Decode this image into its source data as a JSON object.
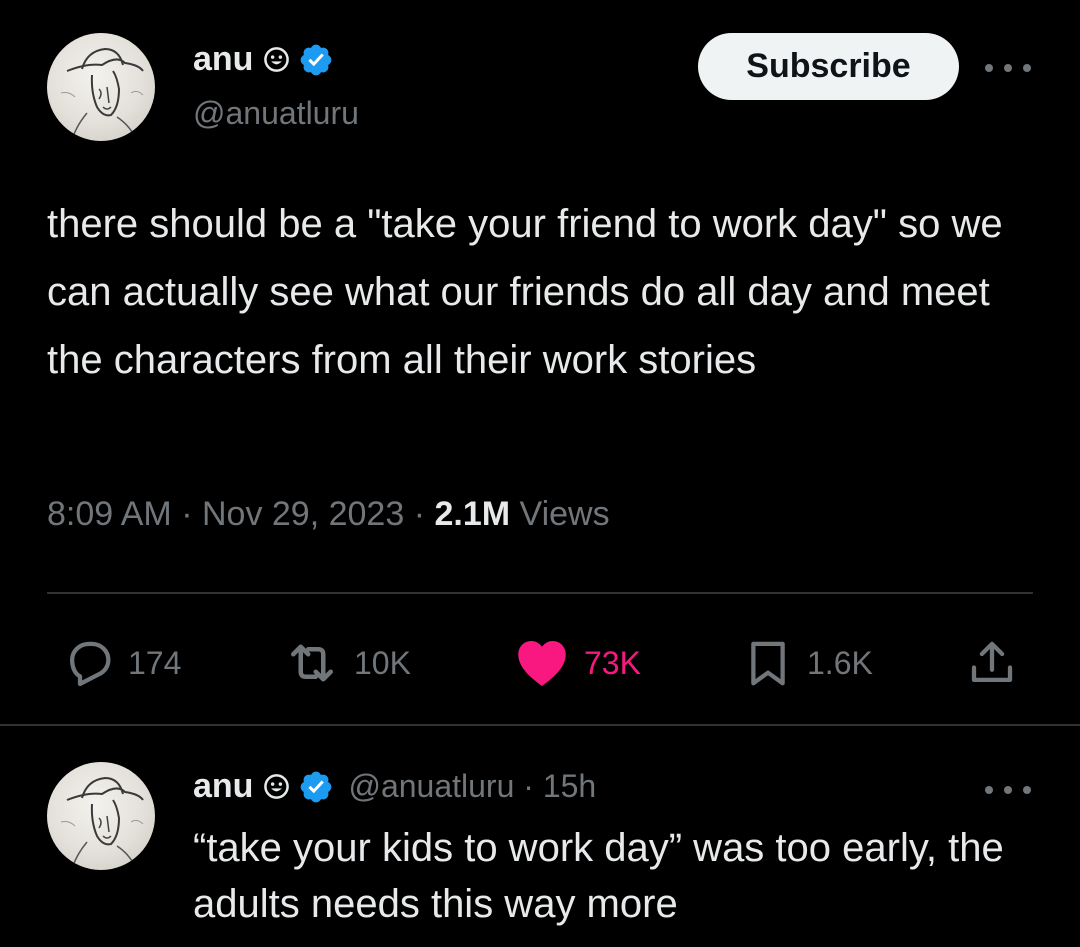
{
  "colors": {
    "background": "#000000",
    "text_primary": "#e7e9ea",
    "text_secondary": "#71767b",
    "verified_blue": "#1d9bf0",
    "like_pink": "#f91880",
    "divider": "#2f3336",
    "subscribe_bg": "#eff3f4"
  },
  "tweet": {
    "author": {
      "display_name": "anu",
      "emoji_icon": "smiley-face-icon",
      "verified_icon": "verified-badge-icon",
      "handle": "@anuatluru",
      "avatar_icon": "cowboy-sketch-avatar"
    },
    "subscribe_label": "Subscribe",
    "more_icon": "more-dots-icon",
    "text": "there should be a \"take your friend to work day\" so we can actually see what our friends do all day and meet the characters from all their work stories",
    "time": "8:09 AM",
    "separator": "·",
    "date": "Nov 29, 2023",
    "views_count": "2.1M",
    "views_label": "Views",
    "actions": {
      "reply": {
        "icon": "reply-icon",
        "count": "174"
      },
      "retweet": {
        "icon": "retweet-icon",
        "count": "10K"
      },
      "like": {
        "icon": "heart-icon",
        "count": "73K",
        "liked": true
      },
      "bookmark": {
        "icon": "bookmark-icon",
        "count": "1.6K"
      },
      "share": {
        "icon": "share-icon"
      }
    }
  },
  "reply": {
    "author": {
      "display_name": "anu",
      "emoji_icon": "smiley-face-icon",
      "verified_icon": "verified-badge-icon",
      "handle": "@anuatluru",
      "avatar_icon": "cowboy-sketch-avatar"
    },
    "handle_time": "@anuatluru · 15h",
    "more_icon": "more-dots-icon",
    "text": "“take your kids to work day” was too early, the adults needs this way more"
  }
}
